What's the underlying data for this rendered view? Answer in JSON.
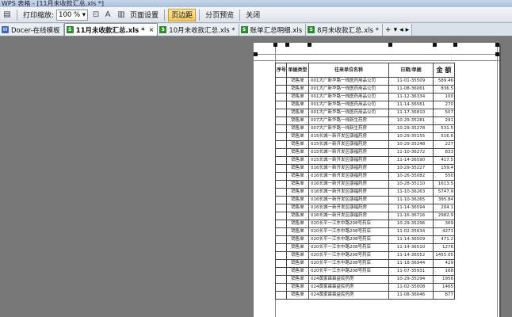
{
  "window": {
    "title": "WPS 表格 - [11月未收款汇总.xls *]"
  },
  "toolbar": {
    "print_zoom_label": "打印缩放:",
    "zoom_value": "100 %",
    "page_setup": "页面设置",
    "margins": "页边距",
    "page_break_preview": "分页预览",
    "close": "关闭"
  },
  "tabs": [
    {
      "label": "Docer-在线模板",
      "icon": "web",
      "close": ""
    },
    {
      "label": "11月未收款汇总.xls *",
      "icon": "xls",
      "close": "×"
    },
    {
      "label": "10月未收款汇总.xls *",
      "icon": "xls",
      "close": ""
    },
    {
      "label": "账单汇总明细.xls",
      "icon": "xls",
      "close": ""
    },
    {
      "label": "8月未收款汇总.xls *",
      "icon": "xls",
      "close": ""
    }
  ],
  "sheet": {
    "headers": [
      "序号",
      "单据类型",
      "往来单位名称",
      "日期/单据",
      "金 额"
    ],
    "rows": [
      [
        "",
        "销售单",
        "001大广新华路一线医药用品公司",
        "11-01-35509",
        "589.46"
      ],
      [
        "",
        "销售单",
        "001大广新华路一线医药用品公司",
        "11-08-36061",
        "836.5"
      ],
      [
        "",
        "销售单",
        "001大广新华路一线医药用品公司",
        "11-12-36334",
        "100"
      ],
      [
        "",
        "销售单",
        "001大广新华路一线医药用品公司",
        "11-14-36561",
        "270"
      ],
      [
        "",
        "销售单",
        "001大广新华路一线医药用品公司",
        "11-17-36810",
        "507"
      ],
      [
        "",
        "销售单",
        "007大广新华路一线新生药房",
        "10-29-35281",
        "291"
      ],
      [
        "",
        "销售单",
        "007大广新华路一线新生药房",
        "10-29-35278",
        "531.5"
      ],
      [
        "",
        "销售单",
        "015长城一新开发区康福药房",
        "10-29-35155",
        "516.6"
      ],
      [
        "",
        "销售单",
        "015长城一新开发区康福药房",
        "10-29-35248",
        "227"
      ],
      [
        "",
        "销售单",
        "015长城一新开发区康福药房",
        "11-10-36272",
        "833"
      ],
      [
        "",
        "销售单",
        "015长城一新开发区康福药房",
        "11-14-36590",
        "417.5"
      ],
      [
        "",
        "销售单",
        "016长城一新开发区康福药房",
        "10-29-35227",
        "159.4"
      ],
      [
        "",
        "销售单",
        "016长城一新开发区康福药房",
        "10-26-35082",
        "550"
      ],
      [
        "",
        "销售单",
        "016长城一新开发区康福药房",
        "10-28-35110",
        "1613.5"
      ],
      [
        "",
        "销售单",
        "016长城一新开发区康福药房",
        "11-10-36263",
        "5747.9"
      ],
      [
        "",
        "销售单",
        "016长城一新开发区康福药房",
        "11-10-36265",
        "395.84"
      ],
      [
        "",
        "销售单",
        "016长城一新开发区康福药房",
        "11-14-36594",
        "204.1"
      ],
      [
        "",
        "销售单",
        "016长城一新开发区康福药房",
        "11-16-36716",
        "2982.9"
      ],
      [
        "",
        "销售单",
        "020长平一江东中路208号药店",
        "10-29-35296",
        "369"
      ],
      [
        "",
        "销售单",
        "020长平一江东中路208号药店",
        "11-02-35634",
        "4271"
      ],
      [
        "",
        "销售单",
        "020长平一江东中路208号药店",
        "11-14-36509",
        "471.2"
      ],
      [
        "",
        "销售单",
        "020长平一江东中路208号药店",
        "11-14-36510",
        "1276"
      ],
      [
        "",
        "销售单",
        "020长平一江东中路208号药店",
        "11-14-36552",
        "1455.05"
      ],
      [
        "",
        "销售单",
        "020长平一江东中路208号药店",
        "11-18-36944",
        "429"
      ],
      [
        "",
        "销售单",
        "020长平一江东中路208号药店",
        "11-07-35931",
        "168"
      ],
      [
        "",
        "销售单",
        "024黄家霖霖益民药房",
        "10-29-35294",
        "1956"
      ],
      [
        "",
        "销售单",
        "024黄家霖霖益民药房",
        "11-02-35008",
        "1465"
      ],
      [
        "",
        "销售单",
        "024黄家霖霖益民药房",
        "11-08-36046",
        "877"
      ]
    ]
  }
}
